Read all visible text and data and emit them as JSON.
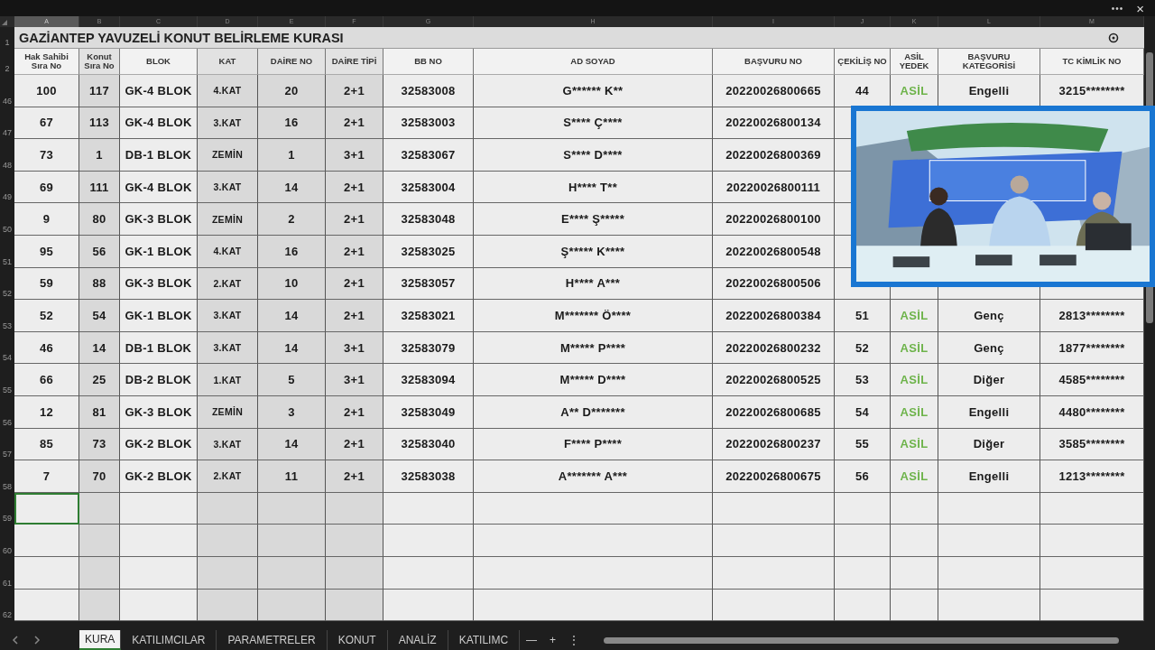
{
  "window": {
    "controls": [
      "•••",
      "×"
    ]
  },
  "sheet": {
    "column_letters": [
      "A",
      "B",
      "C",
      "D",
      "E",
      "F",
      "G",
      "H",
      "I",
      "J",
      "K",
      "L",
      "M"
    ],
    "title": {
      "number": "1",
      "text": "GAZİANTEP YAVUZELİ KONUT BELİRLEME KURASI"
    },
    "header": {
      "number": "2",
      "columns": [
        {
          "label": "Hak Sahibi Sıra No",
          "shaded": false,
          "kind": "plain"
        },
        {
          "label": "Konut Sıra No",
          "shaded": true,
          "kind": "plain"
        },
        {
          "label": "BLOK",
          "shaded": false,
          "kind": "plain"
        },
        {
          "label": "KAT",
          "shaded": true,
          "kind": "small"
        },
        {
          "label": "DAİRE NO",
          "shaded": true,
          "kind": "plain"
        },
        {
          "label": "DAİRE TİPİ",
          "shaded": true,
          "kind": "plain"
        },
        {
          "label": "BB NO",
          "shaded": false,
          "kind": "plain"
        },
        {
          "label": "AD SOYAD",
          "shaded": false,
          "kind": "plain"
        },
        {
          "label": "BAŞVURU NO",
          "shaded": false,
          "kind": "plain"
        },
        {
          "label": "ÇEKİLİŞ NO",
          "shaded": false,
          "kind": "plain"
        },
        {
          "label": "ASİL YEDEK",
          "shaded": false,
          "kind": "status"
        },
        {
          "label": "BAŞVURU KATEGORİSİ",
          "shaded": false,
          "kind": "plain"
        },
        {
          "label": "TC KİMLİK NO",
          "shaded": false,
          "kind": "plain"
        }
      ]
    },
    "rows": [
      {
        "number": "46",
        "cells": [
          "100",
          "117",
          "GK-4 BLOK",
          "4.KAT",
          "20",
          "2+1",
          "32583008",
          "G****** K**",
          "20220026800665",
          "44",
          "ASİL",
          "Engelli",
          "3215********"
        ]
      },
      {
        "number": "47",
        "cells": [
          "67",
          "113",
          "GK-4 BLOK",
          "3.KAT",
          "16",
          "2+1",
          "32583003",
          "S**** Ç****",
          "20220026800134"
        ]
      },
      {
        "number": "48",
        "cells": [
          "73",
          "1",
          "DB-1 BLOK",
          "ZEMİN",
          "1",
          "3+1",
          "32583067",
          "S**** D****",
          "20220026800369"
        ]
      },
      {
        "number": "49",
        "cells": [
          "69",
          "111",
          "GK-4 BLOK",
          "3.KAT",
          "14",
          "2+1",
          "32583004",
          "H**** T**",
          "20220026800111"
        ]
      },
      {
        "number": "50",
        "cells": [
          "9",
          "80",
          "GK-3 BLOK",
          "ZEMİN",
          "2",
          "2+1",
          "32583048",
          "E**** Ş*****",
          "20220026800100"
        ]
      },
      {
        "number": "51",
        "cells": [
          "95",
          "56",
          "GK-1 BLOK",
          "4.KAT",
          "16",
          "2+1",
          "32583025",
          "Ş***** K****",
          "20220026800548"
        ]
      },
      {
        "number": "52",
        "cells": [
          "59",
          "88",
          "GK-3 BLOK",
          "2.KAT",
          "10",
          "2+1",
          "32583057",
          "H**** A***",
          "20220026800506"
        ]
      },
      {
        "number": "53",
        "cells": [
          "52",
          "54",
          "GK-1 BLOK",
          "3.KAT",
          "14",
          "2+1",
          "32583021",
          "M******* Ö****",
          "20220026800384",
          "51",
          "ASİL",
          "Genç",
          "2813********"
        ]
      },
      {
        "number": "54",
        "cells": [
          "46",
          "14",
          "DB-1 BLOK",
          "3.KAT",
          "14",
          "3+1",
          "32583079",
          "M***** P****",
          "20220026800232",
          "52",
          "ASİL",
          "Genç",
          "1877********"
        ]
      },
      {
        "number": "55",
        "cells": [
          "66",
          "25",
          "DB-2 BLOK",
          "1.KAT",
          "5",
          "3+1",
          "32583094",
          "M***** D****",
          "20220026800525",
          "53",
          "ASİL",
          "Diğer",
          "4585********"
        ]
      },
      {
        "number": "56",
        "cells": [
          "12",
          "81",
          "GK-3 BLOK",
          "ZEMİN",
          "3",
          "2+1",
          "32583049",
          "A** D*******",
          "20220026800685",
          "54",
          "ASİL",
          "Engelli",
          "4480********"
        ]
      },
      {
        "number": "57",
        "cells": [
          "85",
          "73",
          "GK-2 BLOK",
          "3.KAT",
          "14",
          "2+1",
          "32583040",
          "F**** P****",
          "20220026800237",
          "55",
          "ASİL",
          "Diğer",
          "3585********"
        ]
      },
      {
        "number": "58",
        "cells": [
          "7",
          "70",
          "GK-2 BLOK",
          "2.KAT",
          "11",
          "2+1",
          "32583038",
          "A******* A***",
          "20220026800675",
          "56",
          "ASİL",
          "Engelli",
          "1213********"
        ]
      }
    ],
    "empty_rows": [
      {
        "number": "59",
        "selected": true
      },
      {
        "number": "60",
        "selected": false
      },
      {
        "number": "61",
        "selected": false
      },
      {
        "number": "62",
        "selected": false
      }
    ]
  },
  "video_overlay": {
    "kind": "picture"
  },
  "tabs": [
    {
      "label": "KURA",
      "selected": true
    },
    {
      "label": "KATILIMCILAR",
      "selected": false
    },
    {
      "label": "PARAMETRELER",
      "selected": false
    },
    {
      "label": "KONUT",
      "selected": false
    },
    {
      "label": "ANALİZ",
      "selected": false
    },
    {
      "label": "KATILIMC",
      "selected": false
    }
  ],
  "tab_actions": [
    "—",
    "+",
    "⋮"
  ]
}
